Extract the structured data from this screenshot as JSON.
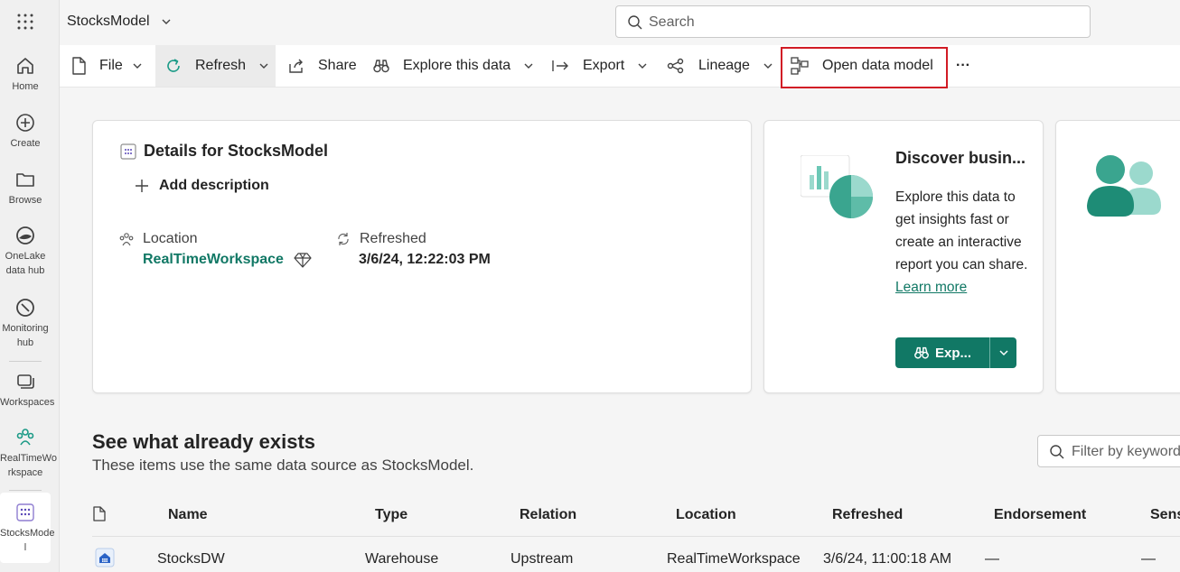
{
  "rail": {
    "items": [
      {
        "label": "Home"
      },
      {
        "label": "Create"
      },
      {
        "label": "Browse"
      },
      {
        "label_line1": "OneLake",
        "label_line2": "data hub"
      },
      {
        "label_line1": "Monitoring",
        "label_line2": "hub"
      },
      {
        "label": "Workspaces"
      },
      {
        "label_line1": "RealTimeWo",
        "label_line2": "rkspace"
      },
      {
        "label_line1": "StocksMode",
        "label_line2": "l"
      }
    ]
  },
  "header": {
    "breadcrumb": "StocksModel",
    "search_placeholder": "Search"
  },
  "ribbon": {
    "file": "File",
    "refresh": "Refresh",
    "share": "Share",
    "explore": "Explore this data",
    "export": "Export",
    "lineage": "Lineage",
    "open_model": "Open data model",
    "more": "···"
  },
  "details": {
    "title": "Details for StocksModel",
    "add_description": "Add description",
    "location_label": "Location",
    "location_value": "RealTimeWorkspace",
    "refreshed_label": "Refreshed",
    "refreshed_value": "3/6/24, 12:22:03 PM"
  },
  "discover": {
    "title": "Discover busin...",
    "body": "Explore this data to get insights fast or create an interactive report you can share.",
    "learn_more": "Learn more",
    "button": "Exp..."
  },
  "existing": {
    "title": "See what already exists",
    "subtitle": "These items use the same data source as StocksModel.",
    "filter_placeholder": "Filter by keyword",
    "columns": [
      "Name",
      "Type",
      "Relation",
      "Location",
      "Refreshed",
      "Endorsement",
      "Sens"
    ],
    "rows": [
      {
        "name": "StocksDW",
        "type": "Warehouse",
        "relation": "Upstream",
        "location": "RealTimeWorkspace",
        "refreshed": "3/6/24, 11:00:18 AM",
        "endorsement": "—",
        "sensitivity": "—"
      }
    ]
  },
  "colors": {
    "accent": "#117865",
    "highlight_border": "#d11b25"
  }
}
